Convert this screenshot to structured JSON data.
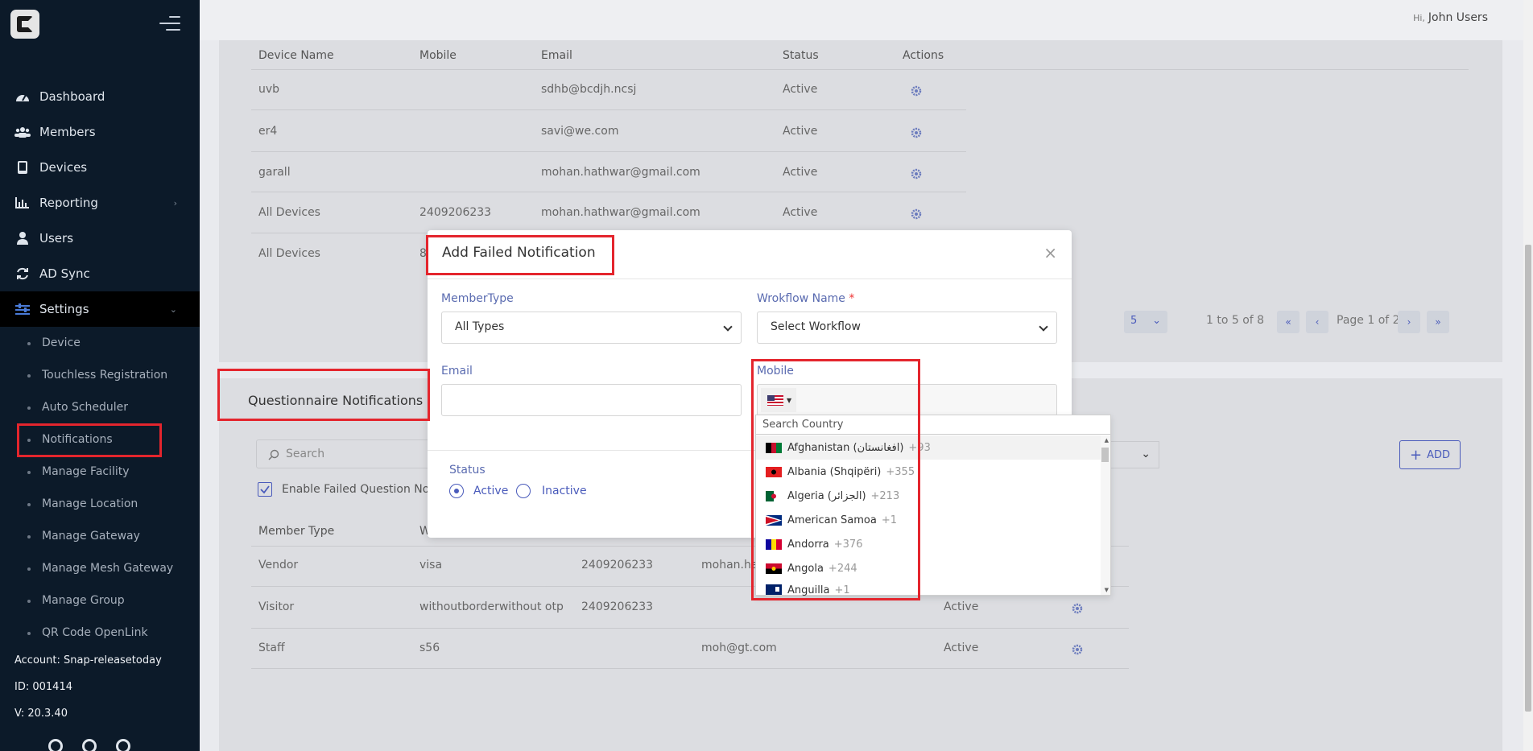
{
  "sidebar": {
    "nav": [
      {
        "label": "Dashboard",
        "icon": "dashboard-icon"
      },
      {
        "label": "Members",
        "icon": "members-icon"
      },
      {
        "label": "Devices",
        "icon": "devices-icon"
      },
      {
        "label": "Reporting",
        "icon": "reporting-icon"
      },
      {
        "label": "Users",
        "icon": "user-icon"
      },
      {
        "label": "AD Sync",
        "icon": "sync-icon"
      },
      {
        "label": "Settings",
        "icon": "settings-icon"
      }
    ],
    "sub": [
      "Device",
      "Touchless Registration",
      "Auto Scheduler",
      "Notifications",
      "Manage Facility",
      "Manage Location",
      "Manage Gateway",
      "Manage Mesh Gateway",
      "Manage Group",
      "QR Code OpenLink"
    ],
    "account": "Account: Snap-releasetoday",
    "id": "ID: 001414",
    "version": "V: 20.3.40"
  },
  "topbar": {
    "greeting": "Hi,",
    "user": "John Users"
  },
  "devices_table": {
    "headers": [
      "Device Name",
      "Mobile",
      "Email",
      "Status",
      "Actions"
    ],
    "rows": [
      [
        "uvb",
        "",
        "sdhb@bcdjh.ncsj",
        "Active"
      ],
      [
        "er4",
        "",
        "savi@we.com",
        "Active"
      ],
      [
        "garall",
        "",
        "mohan.hathwar@gmail.com",
        "Active"
      ],
      [
        "All Devices",
        "2409206233",
        "mohan.hathwar@gmail.com",
        "Active"
      ],
      [
        "All Devices",
        "8",
        "",
        ""
      ]
    ],
    "page_size": "5",
    "range": "1 to 5 of 8",
    "page": "Page 1 of 2"
  },
  "questionnaire": {
    "title": "Questionnaire Notifications",
    "search_placeholder": "Search",
    "enable_label": "Enable Failed Question Notif",
    "add_label": "ADD",
    "headers": [
      "Member Type",
      "W"
    ],
    "rows": [
      [
        "Vendor",
        "visa",
        "2409206233",
        "mohan.ha",
        ""
      ],
      [
        "Visitor",
        "withoutborderwithout otp",
        "2409206233",
        "",
        "Active"
      ],
      [
        "Staff",
        "s56",
        "",
        "moh@gt.com",
        "Active"
      ]
    ]
  },
  "modal": {
    "title": "Add Failed Notification",
    "close": "×",
    "member_type_label": "MemberType",
    "member_type_value": "All Types",
    "workflow_label": "Wrokflow Name",
    "workflow_required": "*",
    "workflow_value": "Select Workflow",
    "email_label": "Email",
    "mobile_label": "Mobile",
    "status_label": "Status",
    "active_label": "Active",
    "inactive_label": "Inactive",
    "status_selected": "Active"
  },
  "country_dropdown": {
    "search_placeholder": "Search Country",
    "countries": [
      {
        "name": "Afghanistan (افغانستان)",
        "dial": "+93"
      },
      {
        "name": "Albania (Shqipëri)",
        "dial": "+355"
      },
      {
        "name": "Algeria (الجزائر)",
        "dial": "+213"
      },
      {
        "name": "American Samoa",
        "dial": "+1"
      },
      {
        "name": "Andorra",
        "dial": "+376"
      },
      {
        "name": "Angola",
        "dial": "+244"
      },
      {
        "name": "Anguilla",
        "dial": "+1"
      }
    ]
  },
  "colors": {
    "accent": "#4a5bbb",
    "highlight": "#e4252d",
    "sidebar": "#0c1a29"
  }
}
